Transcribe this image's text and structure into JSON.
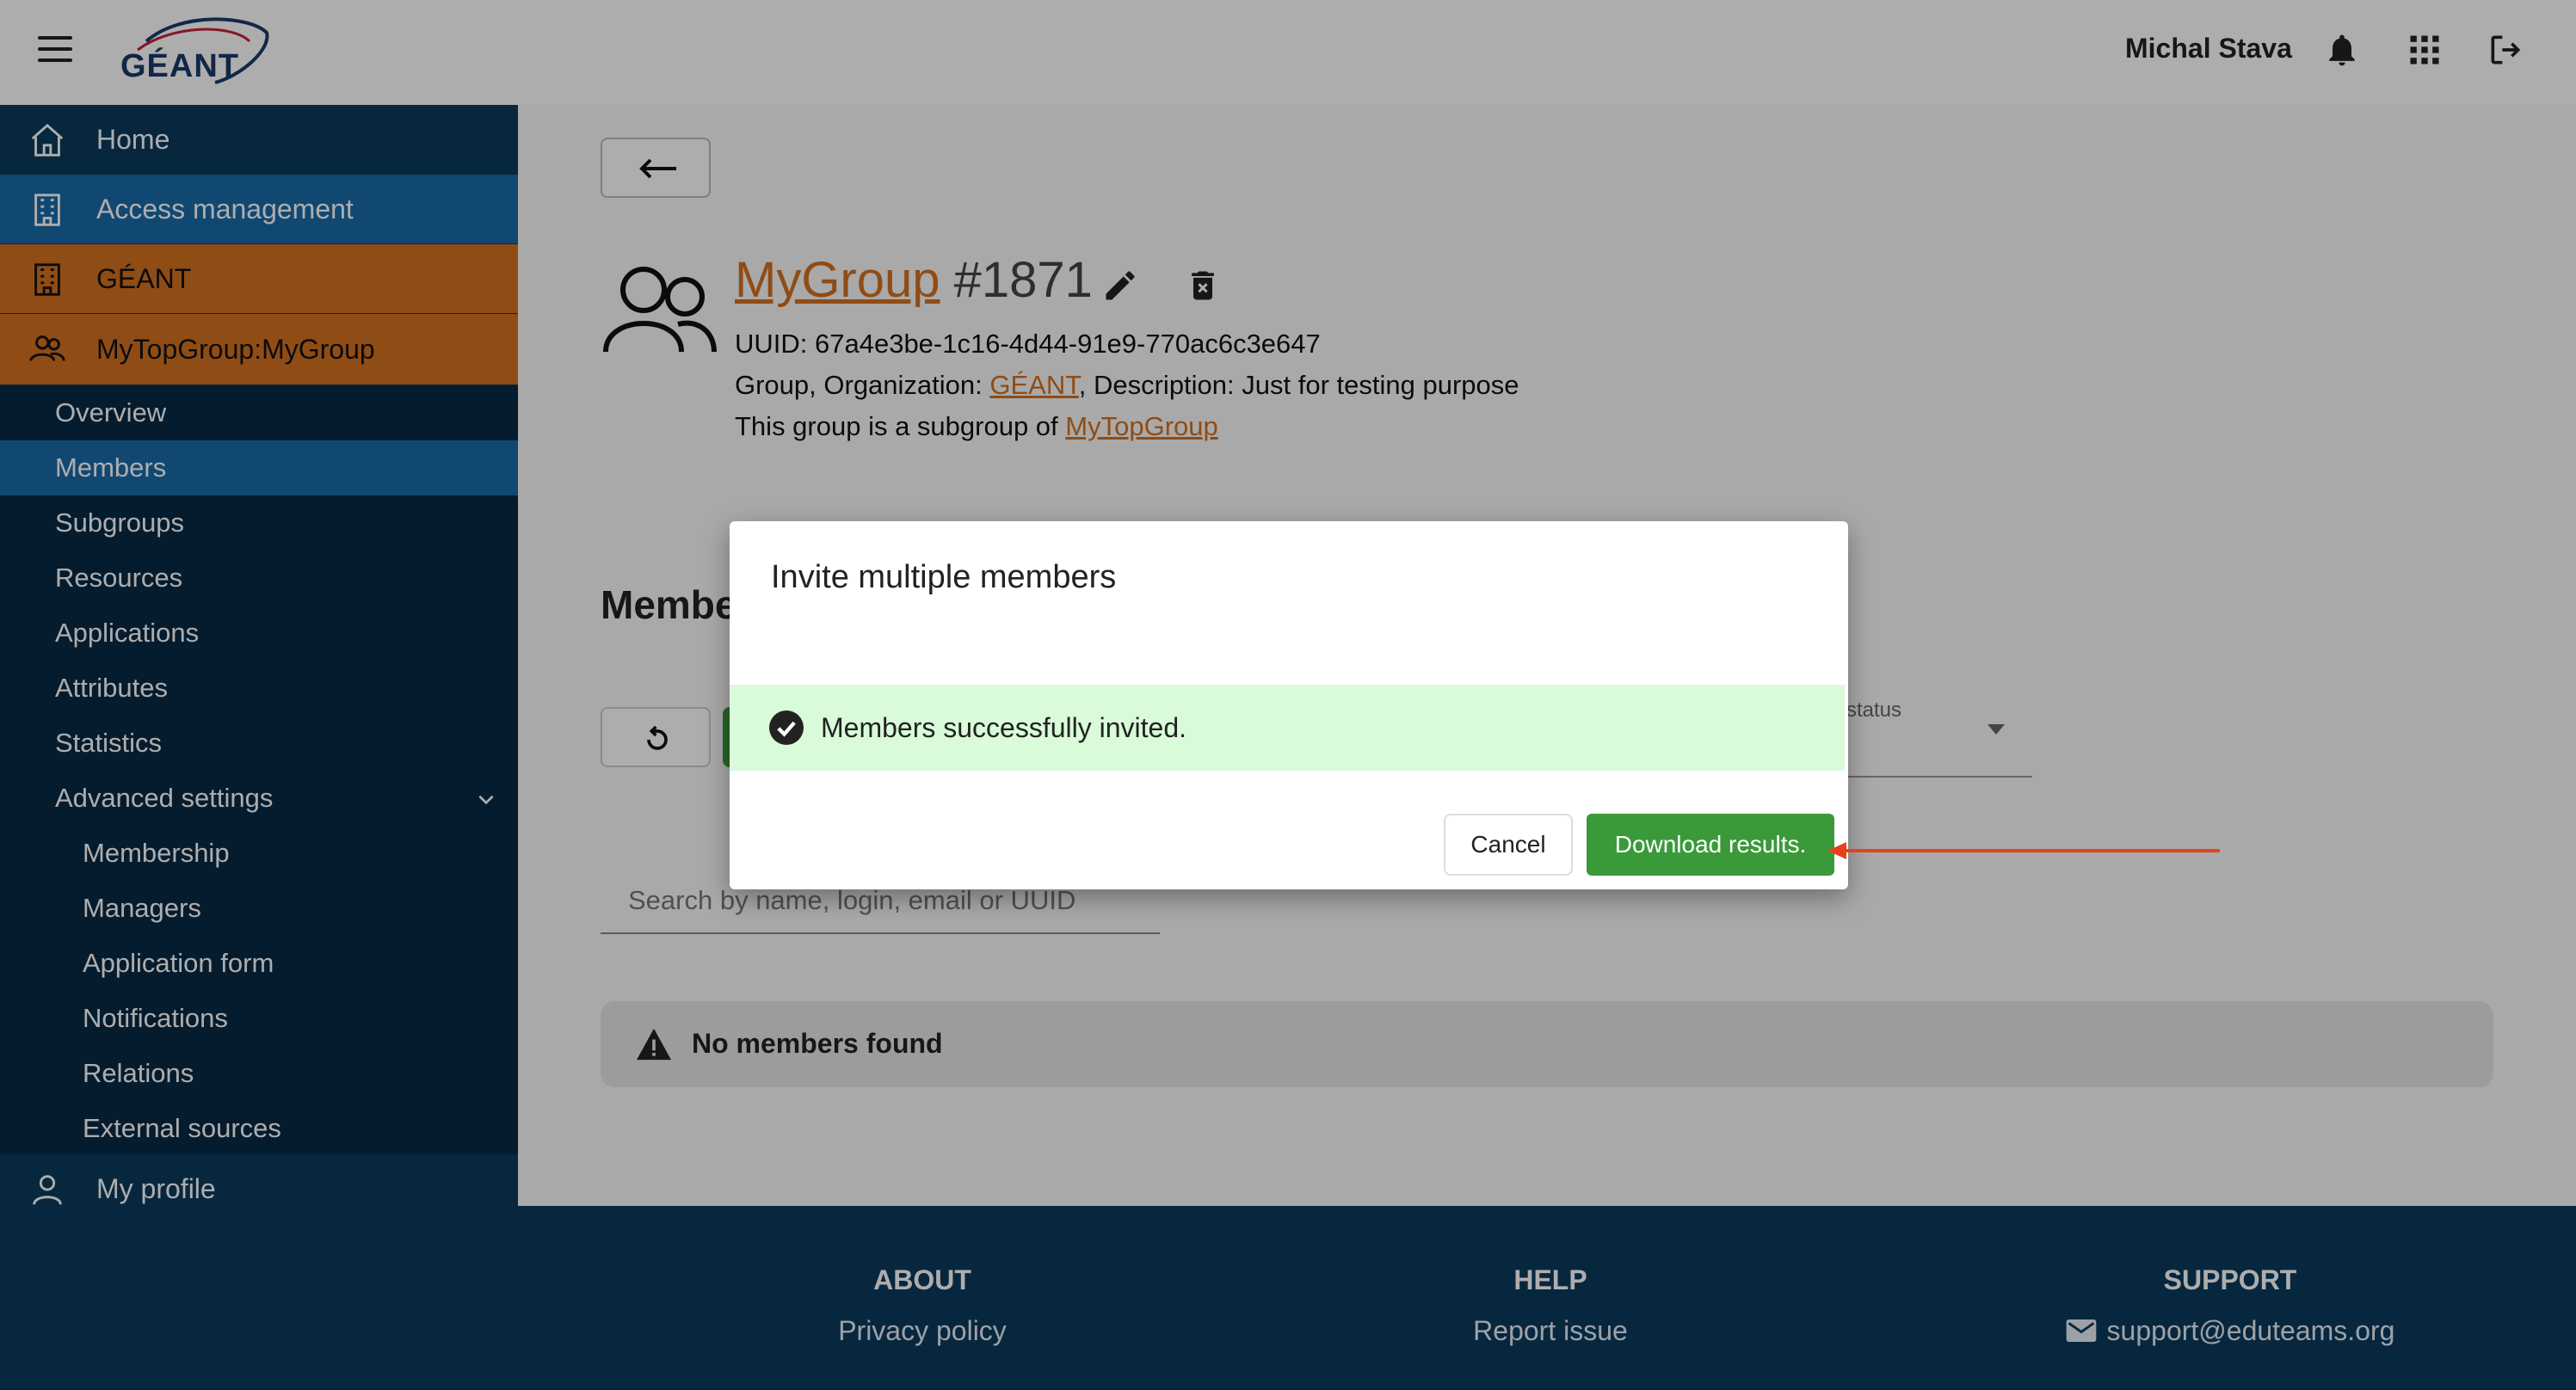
{
  "header": {
    "logo_text": "GÉANT",
    "user_name": "Michal Stava",
    "icons": [
      "menu-icon",
      "bell-icon",
      "apps-grid-icon",
      "logout-icon"
    ]
  },
  "sidebar": {
    "home": "Home",
    "access_management": "Access management",
    "organization": "GÉANT",
    "group": "MyTopGroup:MyGroup",
    "sub_items": [
      "Overview",
      "Members",
      "Subgroups",
      "Resources",
      "Applications",
      "Attributes",
      "Statistics",
      "Advanced settings"
    ],
    "advanced_items": [
      "Membership",
      "Managers",
      "Application form",
      "Notifications",
      "Relations",
      "External sources"
    ],
    "my_profile": "My profile",
    "active_item": "Members"
  },
  "group": {
    "name": "MyGroup",
    "id": "#1871",
    "uuid_line": "UUID: 67a4e3be-1c16-4d44-91e9-770ac6c3e647",
    "org_prefix": "Group, Organization: ",
    "org_name": "GÉANT",
    "desc_suffix": ", Description: Just for testing purpose",
    "subgroup_prefix": "This group is a subgroup of ",
    "parent_name": "MyTopGroup"
  },
  "members_section": {
    "heading": "Members",
    "status_label": "status",
    "search_placeholder": "Search by name, login, email or UUID",
    "empty_message": "No members found"
  },
  "dialog": {
    "title": "Invite multiple members",
    "success_message": "Members successfully invited.",
    "cancel_label": "Cancel",
    "download_label": "Download results."
  },
  "footer": {
    "about_heading": "ABOUT",
    "about_link": "Privacy policy",
    "help_heading": "HELP",
    "help_link": "Report issue",
    "support_heading": "SUPPORT",
    "support_link": "support@eduteams.org"
  },
  "colors": {
    "sidebar_bg": "#0b3a5e",
    "active_blue": "#1a6aa8",
    "accent_orange": "#d5701f",
    "success_green": "#3a9a3a",
    "success_bg": "#d9fbd9",
    "annotation_arrow": "#e8401e"
  }
}
